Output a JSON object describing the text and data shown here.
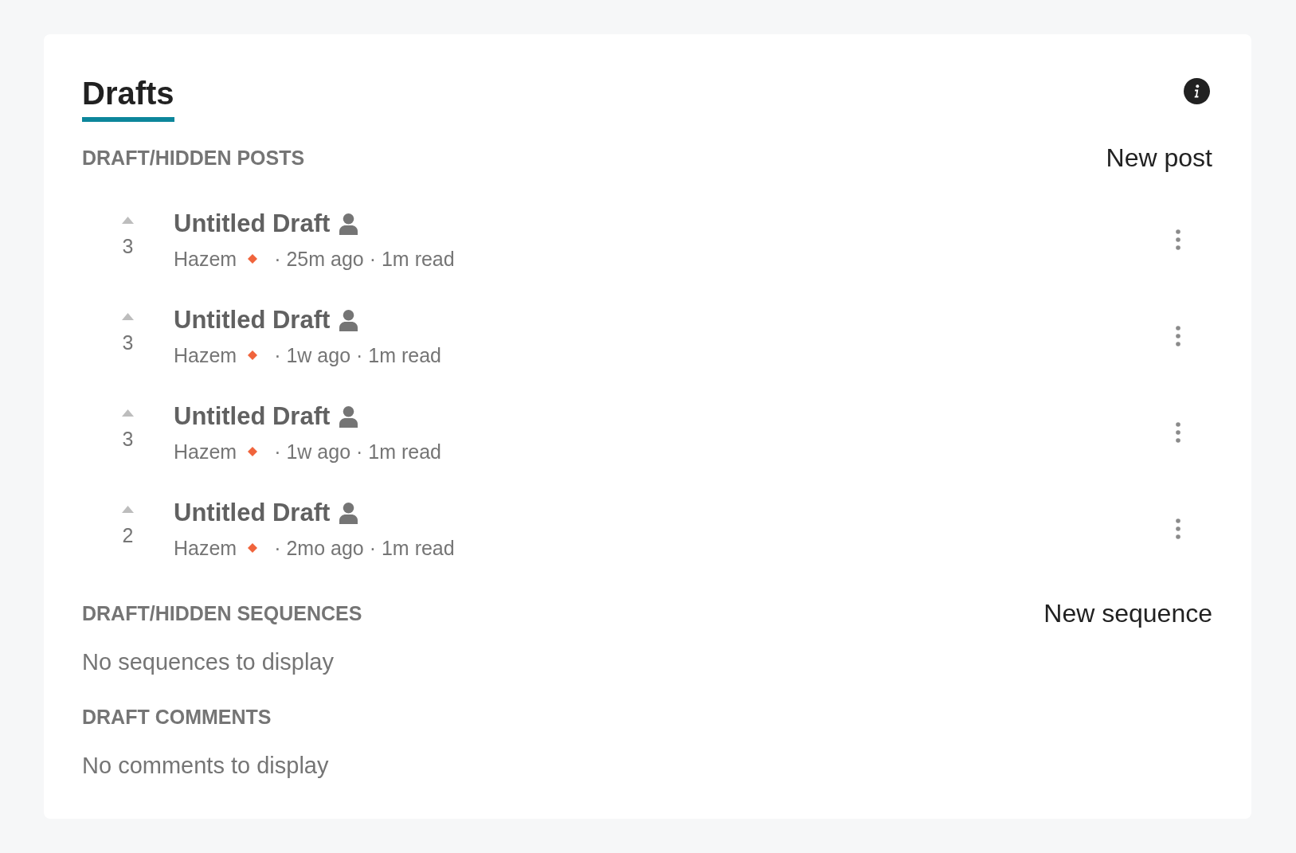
{
  "header": {
    "title": "Drafts"
  },
  "posts_section": {
    "heading": "DRAFT/HIDDEN POSTS",
    "action": "New post",
    "posts": [
      {
        "score": "3",
        "title": "Untitled Draft",
        "author": "Hazem",
        "meta": "· 25m ago · 1m read"
      },
      {
        "score": "3",
        "title": "Untitled Draft",
        "author": "Hazem",
        "meta": "· 1w ago · 1m read"
      },
      {
        "score": "3",
        "title": "Untitled Draft",
        "author": "Hazem",
        "meta": "· 1w ago · 1m read"
      },
      {
        "score": "2",
        "title": "Untitled Draft",
        "author": "Hazem",
        "meta": "· 2mo ago · 1m read"
      }
    ]
  },
  "sequences_section": {
    "heading": "DRAFT/HIDDEN SEQUENCES",
    "action": "New sequence",
    "empty_text": "No sequences to display"
  },
  "comments_section": {
    "heading": "DRAFT COMMENTS",
    "empty_text": "No comments to display"
  }
}
